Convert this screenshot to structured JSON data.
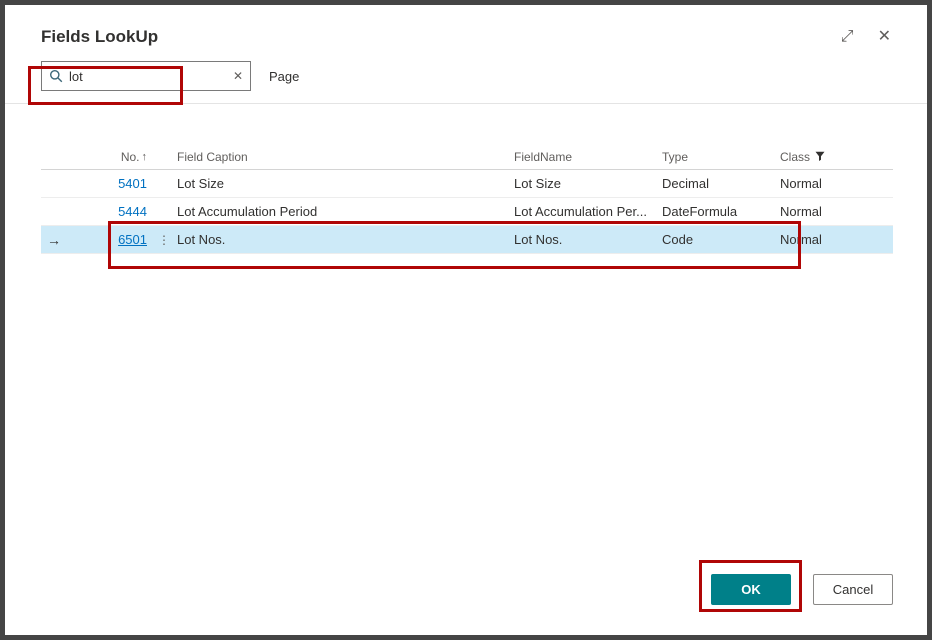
{
  "dialog": {
    "title": "Fields LookUp",
    "window_icons": {
      "resize": "⤢",
      "close": "✕"
    },
    "search": {
      "value": "lot",
      "clear_icon": "✕",
      "scope_label": "Page"
    },
    "table": {
      "headers": {
        "no": "No.",
        "no_sort_icon": "↑",
        "field_caption": "Field Caption",
        "field_name": "FieldName",
        "type": "Type",
        "class": "Class"
      },
      "selected_row_pointer": "→",
      "row_menu_icon": "⋮",
      "rows": [
        {
          "no": "5401",
          "field_caption": "Lot Size",
          "field_name": "Lot Size",
          "type": "Decimal",
          "class": "Normal"
        },
        {
          "no": "5444",
          "field_caption": "Lot Accumulation Period",
          "field_name": "Lot Accumulation Per...",
          "type": "DateFormula",
          "class": "Normal"
        },
        {
          "no": "6501",
          "field_caption": "Lot Nos.",
          "field_name": "Lot Nos.",
          "type": "Code",
          "class": "Normal"
        }
      ]
    },
    "footer": {
      "ok_label": "OK",
      "cancel_label": "Cancel"
    },
    "colors": {
      "primary_button": "#008089",
      "link": "#0071c1",
      "selected_row_bg": "#cdeaf8",
      "annotation_red": "#b00606"
    }
  }
}
